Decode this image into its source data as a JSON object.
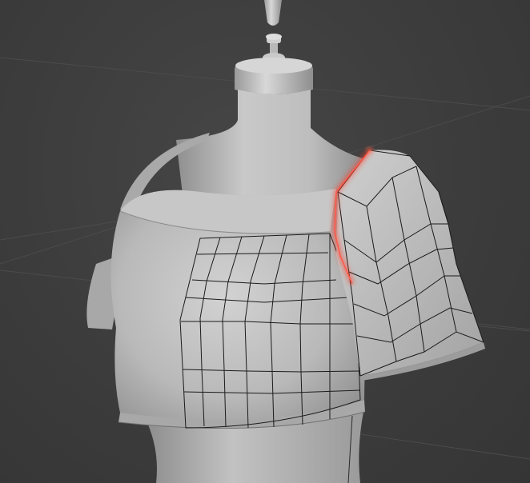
{
  "viewport": {
    "background": "#3d3d3d",
    "grid_color": "#4a4a4a",
    "mannequin_color": "#b9b9b9",
    "garment_color": "#c4c4c4",
    "wire_color": "#1a1a1a",
    "selected_edge_color": "#ff4a3a"
  },
  "scene": {
    "objects": [
      "dress-form",
      "crop-top-bodice",
      "sleeve"
    ],
    "mode": "edit-mesh-wireframe"
  }
}
